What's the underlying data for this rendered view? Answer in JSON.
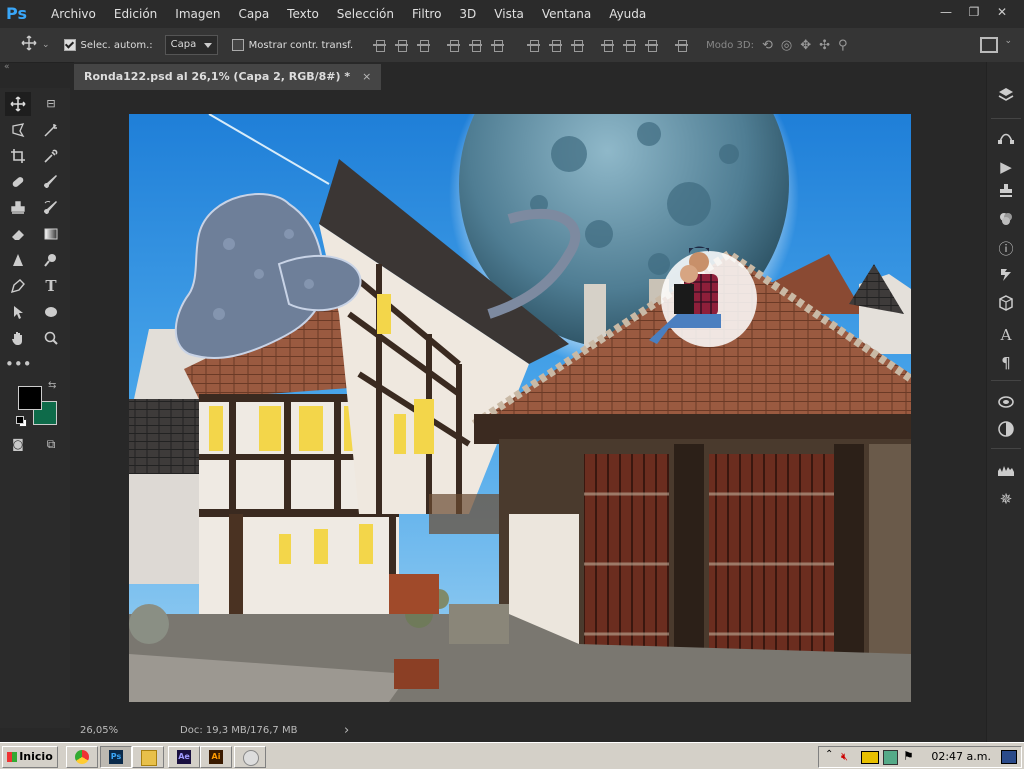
{
  "app": {
    "logo": "Ps"
  },
  "menu": [
    "Archivo",
    "Edición",
    "Imagen",
    "Capa",
    "Texto",
    "Selección",
    "Filtro",
    "3D",
    "Vista",
    "Ventana",
    "Ayuda"
  ],
  "window_controls": {
    "minimize": "—",
    "restore": "❐",
    "close": "✕"
  },
  "options_bar": {
    "auto_select_label": "Selec. autom.:",
    "auto_select_checked": true,
    "auto_select_target": "Capa",
    "show_transform_label": "Mostrar contr. transf.",
    "show_transform_checked": false,
    "mode_3d_label": "Modo 3D:"
  },
  "document": {
    "tab_title": "Ronda122.psd al 26,1% (Capa 2, RGB/8#) *",
    "close_symbol": "×"
  },
  "status": {
    "zoom": "26,05%",
    "doc_info": "Doc: 19,3 MB/176,7 MB",
    "arrow": "›"
  },
  "colors": {
    "foreground": "#000000",
    "background": "#0e6b4a",
    "ps_blue": "#39a6f8"
  },
  "tools_icons": [
    "move-icon",
    "artboard-icon",
    "lasso-icon",
    "magic-wand-icon",
    "crop-icon",
    "eyedropper-icon",
    "healing-brush-icon",
    "brush-icon",
    "clone-stamp-icon",
    "history-brush-icon",
    "eraser-icon",
    "gradient-icon",
    "blur-icon",
    "dodge-icon",
    "pen-icon",
    "type-icon",
    "path-selection-icon",
    "ellipse-icon",
    "hand-icon",
    "zoom-icon",
    "more-tools-icon"
  ],
  "right_panel_icons": [
    "layers-icon",
    "paths-icon",
    "actions-icon",
    "clone-source-icon",
    "color-icon",
    "info-icon",
    "history-icon",
    "3d-icon",
    "character-icon",
    "paragraph-icon",
    "libraries-icon",
    "adjustments-icon",
    "histogram-icon",
    "navigator-icon"
  ],
  "taskbar": {
    "start_label": "Inicio",
    "apps": [
      {
        "name": "chrome",
        "label": ""
      },
      {
        "name": "photoshop",
        "label": "Ps"
      },
      {
        "name": "explorer",
        "label": ""
      },
      {
        "name": "after-effects",
        "label": "Ae"
      },
      {
        "name": "illustrator",
        "label": "Ai"
      },
      {
        "name": "paint",
        "label": ""
      }
    ],
    "clock": "02:47 a.m."
  }
}
